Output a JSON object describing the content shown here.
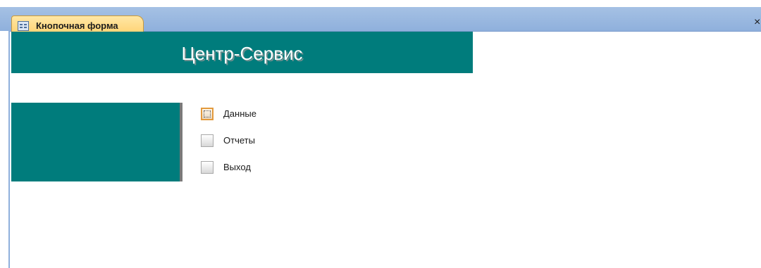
{
  "tab": {
    "label": "Кнопочная форма",
    "icon": "form-icon",
    "close_glyph": "×"
  },
  "form": {
    "title": "Центр-Сервис",
    "colors": {
      "banner": "#007c7c",
      "tab_bar": "#8fb0dc",
      "tab_active": "#ffcf6a",
      "focus_border": "#e39a3d"
    },
    "menu_items": [
      {
        "label": "Данные",
        "focused": true
      },
      {
        "label": "Отчеты",
        "focused": false
      },
      {
        "label": "Выход",
        "focused": false
      }
    ]
  }
}
